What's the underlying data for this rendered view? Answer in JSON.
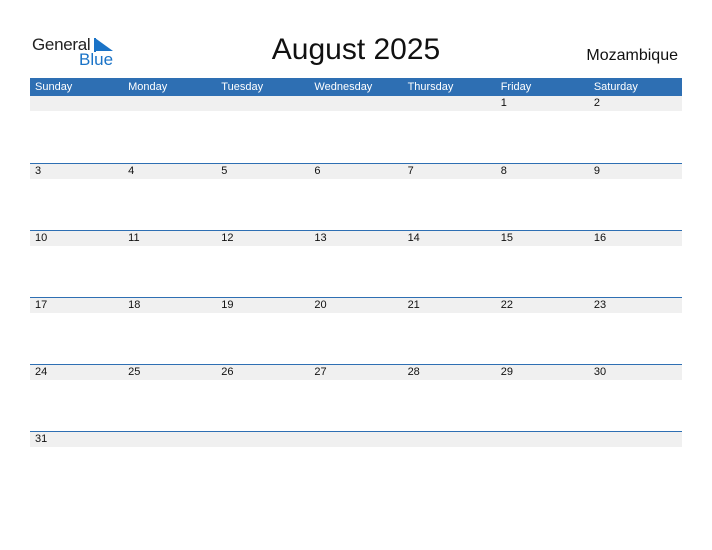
{
  "logo": {
    "word1": "General",
    "word2": "Blue"
  },
  "title": "August 2025",
  "country": "Mozambique",
  "colors": {
    "accent": "#2e6fb3",
    "strip": "#f0f0f0",
    "logo_blue": "#1a73c7"
  },
  "weekdays": [
    "Sunday",
    "Monday",
    "Tuesday",
    "Wednesday",
    "Thursday",
    "Friday",
    "Saturday"
  ],
  "weeks": [
    [
      "",
      "",
      "",
      "",
      "",
      "1",
      "2"
    ],
    [
      "3",
      "4",
      "5",
      "6",
      "7",
      "8",
      "9"
    ],
    [
      "10",
      "11",
      "12",
      "13",
      "14",
      "15",
      "16"
    ],
    [
      "17",
      "18",
      "19",
      "20",
      "21",
      "22",
      "23"
    ],
    [
      "24",
      "25",
      "26",
      "27",
      "28",
      "29",
      "30"
    ],
    [
      "31",
      "",
      "",
      "",
      "",
      "",
      ""
    ]
  ]
}
